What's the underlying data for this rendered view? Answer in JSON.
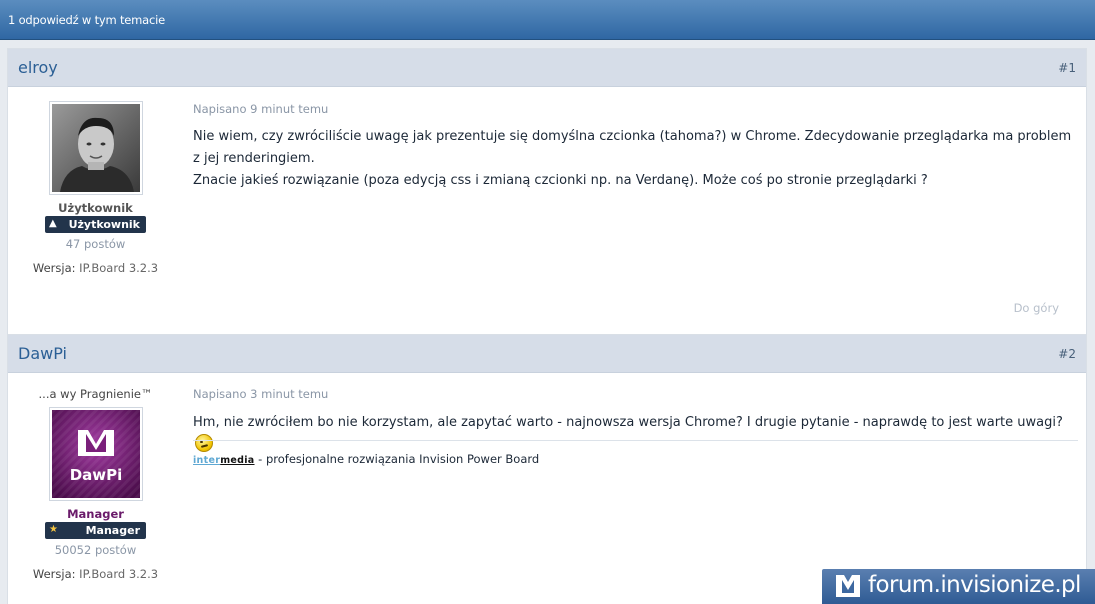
{
  "topbar": {
    "title": "1 odpowiedź w tym temacie"
  },
  "posts": [
    {
      "author": "elroy",
      "number": "#1",
      "group_name": "Użytkownik",
      "group_color": "#555555",
      "badge_label": "Użytkownik",
      "badge_icon": "user-group-icon",
      "posts_count": "47 postów",
      "version_label": "Wersja:",
      "version_value": "IP.Board 3.2.3",
      "posted": "Napisano 9 minut temu",
      "body_lines": [
        "Nie wiem, czy zwróciliście uwagę jak prezentuje się domyślna czcionka (tahoma?) w Chrome. Zdecydowanie przeglądarka ma problem z jej renderingiem.",
        "Znacie jakieś rozwiązanie (poza edycją css i zmianą czcionki np. na Verdanę). Może coś po stronie przeglądarki ?"
      ],
      "to_top": "Do góry"
    },
    {
      "author": "DawPi",
      "number": "#2",
      "title": "...a wy Pragnienie™",
      "avatar_text": "DawPi",
      "group_name": "Manager",
      "group_color": "#6a1b6a",
      "badge_label": "Manager",
      "badge_icon": "star-icon",
      "posts_count": "50052 postów",
      "version_label": "Wersja:",
      "version_value": "IP.Board 3.2.3",
      "posted": "Napisano 3 minut temu",
      "body_lines": [
        "Hm, nie zwróciłem bo nie korzystam, ale zapytać warto - najnowsza wersja Chrome? I drugie pytanie - naprawdę to jest warte uwagi?"
      ],
      "smiley_icon": "smiley-icon",
      "signature": {
        "brand_inter": "inter",
        "brand_media": "media",
        "text": " - profesjonalne rozwiązania Invision Power Board"
      }
    }
  ],
  "watermark": {
    "text": "forum.invisionize.pl"
  }
}
